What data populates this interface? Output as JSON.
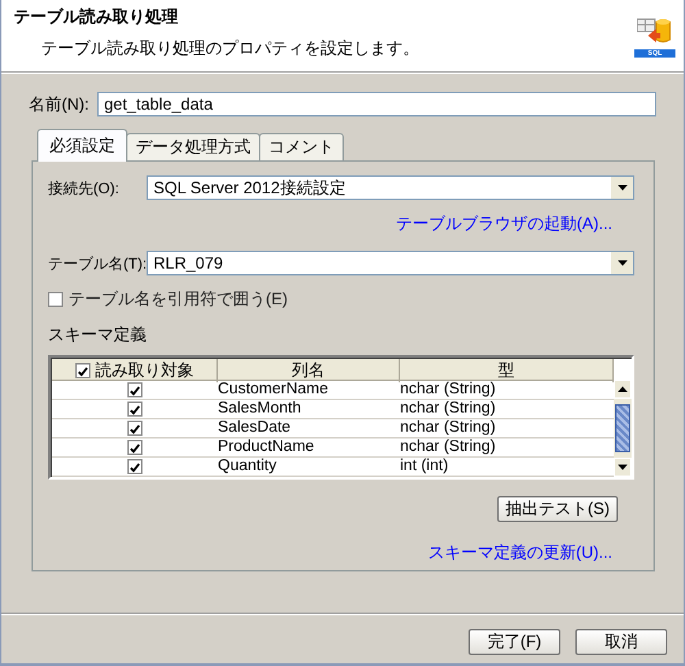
{
  "header": {
    "title": "テーブル読み取り処理",
    "subtitle": "テーブル読み取り処理のプロパティを設定します。",
    "icon_badge": "SQL"
  },
  "name_field": {
    "label": "名前(N):",
    "value": "get_table_data"
  },
  "tabs": [
    {
      "label": "必須設定",
      "selected": true
    },
    {
      "label": "データ処理方式",
      "selected": false
    },
    {
      "label": "コメント",
      "selected": false
    }
  ],
  "connection": {
    "label": "接続先(O):",
    "value": "SQL Server 2012接続設定"
  },
  "browse_link": "テーブルブラウザの起動(A)...",
  "table_name": {
    "label": "テーブル名(T):",
    "value": "RLR_079"
  },
  "quote_option": {
    "label": "テーブル名を引用符で囲う(E)",
    "checked": false
  },
  "schema": {
    "title": "スキーマ定義",
    "header_checked": true,
    "columns": [
      "読み取り対象",
      "列名",
      "型"
    ],
    "rows": [
      {
        "read": true,
        "name": "CustomerName",
        "type": "nchar (String)"
      },
      {
        "read": true,
        "name": "SalesMonth",
        "type": "nchar (String)"
      },
      {
        "read": true,
        "name": "SalesDate",
        "type": "nchar (String)"
      },
      {
        "read": true,
        "name": "ProductName",
        "type": "nchar (String)"
      },
      {
        "read": true,
        "name": "Quantity",
        "type": "int (int)"
      }
    ]
  },
  "extract_button": "抽出テスト(S)",
  "update_link": "スキーマ定義の更新(U)...",
  "buttons": [
    "完了(F)",
    "取消"
  ]
}
